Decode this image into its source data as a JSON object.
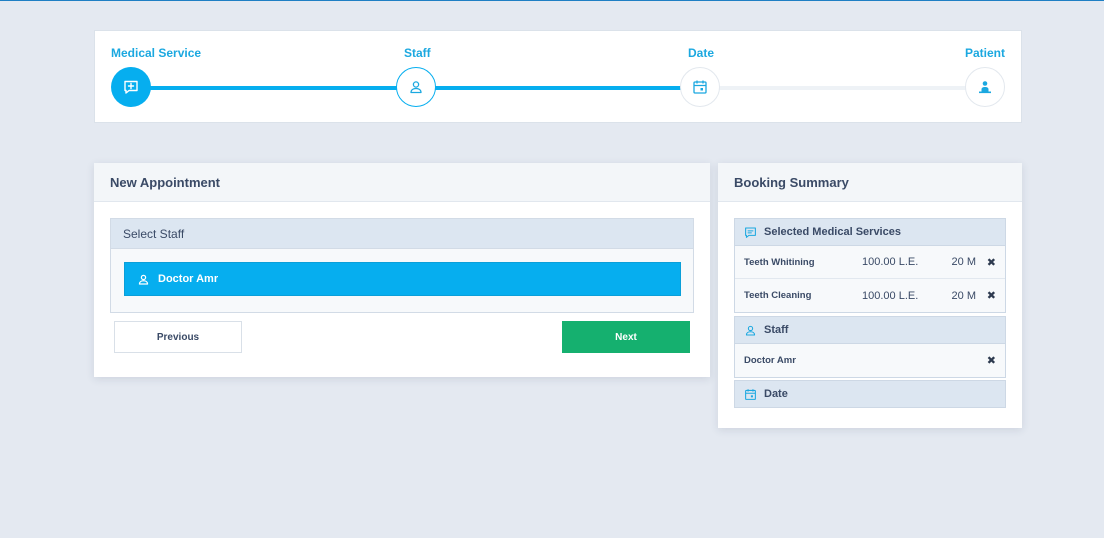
{
  "stepper": {
    "steps": [
      {
        "label": "Medical Service",
        "icon": "medical-chat-icon",
        "state": "active"
      },
      {
        "label": "Staff",
        "icon": "user-icon",
        "state": "done"
      },
      {
        "label": "Date",
        "icon": "calendar-icon",
        "state": "todo"
      },
      {
        "label": "Patient",
        "icon": "patient-icon",
        "state": "todo"
      }
    ]
  },
  "appointment": {
    "title": "New Appointment",
    "select_staff_label": "Select Staff",
    "staff_options": [
      {
        "name": "Doctor Amr",
        "selected": true
      }
    ],
    "previous_label": "Previous",
    "next_label": "Next"
  },
  "summary": {
    "title": "Booking Summary",
    "services_heading": "Selected Medical Services",
    "services": [
      {
        "name": "Teeth Whitining",
        "price": "100.00 L.E.",
        "duration": "20 M"
      },
      {
        "name": "Teeth Cleaning",
        "price": "100.00 L.E.",
        "duration": "20 M"
      }
    ],
    "staff_heading": "Staff",
    "staff_name": "Doctor Amr",
    "date_heading": "Date",
    "remove_symbol": "✖"
  },
  "colors": {
    "accent": "#06aeef",
    "next_button": "#15b06f",
    "background": "#e4e9f1"
  }
}
